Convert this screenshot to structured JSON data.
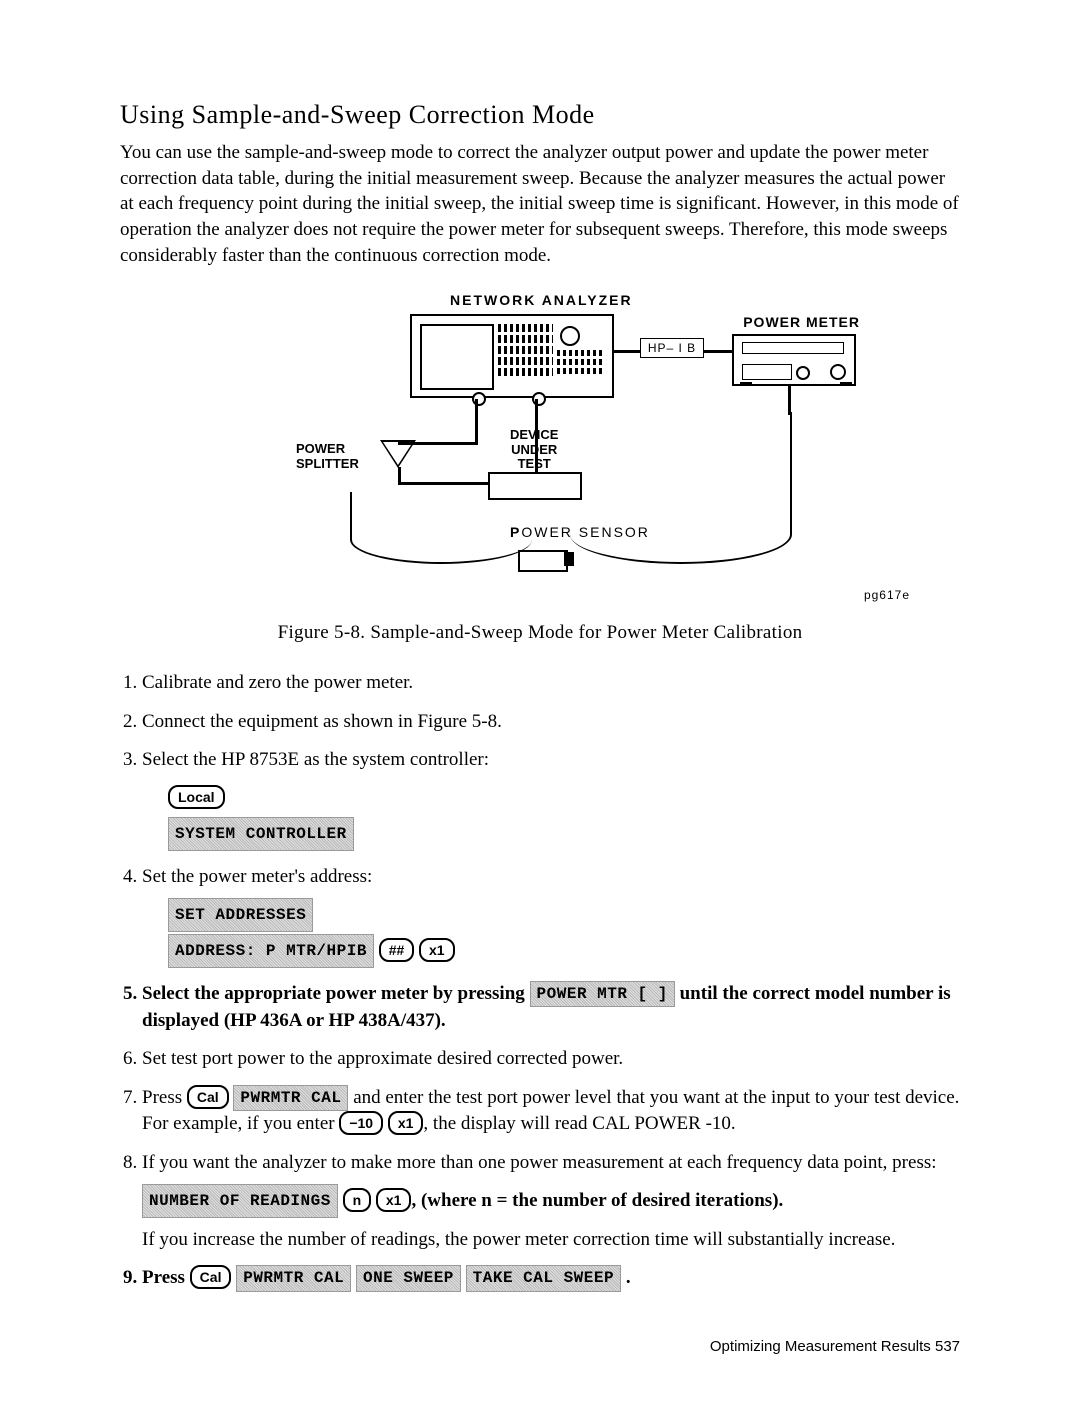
{
  "heading": "Using Sample-and-Sweep Correction Mode",
  "intro": "You can use the sample-and-sweep mode to correct the analyzer output power and update the power meter correction data table, during the initial measurement sweep. Because the analyzer measures the actual power at each frequency point during the initial sweep, the initial sweep time is significant. However, in this mode of operation the analyzer does not require the power meter for subsequent sweeps. Therefore, this mode sweeps considerably faster than the continuous  correction mode.",
  "diagram": {
    "network_analyzer": "NETWORK  ANALYZER",
    "hpib": "HP– I B",
    "power_meter": "POWER  METER",
    "power_splitter_line1": "POWER",
    "power_splitter_line2": "SPLITTER",
    "dut_line1": "DEVICE",
    "dut_line2": "UNDER",
    "dut_line3": "TEST",
    "power_sensor_label": "POWER SENSOR",
    "p_span": "P",
    "figref": "pg617e"
  },
  "figure_caption": "Figure 5-8. Sample-and-Sweep Mode for Power Meter Calibration",
  "steps": {
    "s1": "Calibrate and zero the power meter.",
    "s2": "Connect the equipment as shown in Figure 5-8.",
    "s3": "Select the HP 8753E as the system controller:",
    "s3_local": "Local",
    "s3_syscon": "SYSTEM CONTROLLER",
    "s4": "Set the power meter's address:",
    "s4_setaddr": "SET ADDRESSES",
    "s4_addr": "ADDRESS: P MTR/HPIB",
    "s4_hh": "##",
    "s4_x1": "x1",
    "s5_a": "Select the appropriate power meter by pressing ",
    "s5_key": "POWER MTR [  ]",
    "s5_b": " until the correct model number is displayed (HP 436A or HP 438A/437).",
    "s6": "Set test port power to the approximate desired corrected power.",
    "s7_a": "Press ",
    "s7_cal": "Cal",
    "s7_pwr": "PWRMTR CAL",
    "s7_b": " and enter the test port power level that you want at the input to your test device. For example, if you enter ",
    "s7_m10": "−10",
    "s7_x1": "x1",
    "s7_c": ", the display will read CAL POWER -10.",
    "s8_a": "If you want the analyzer to make more than one power measurement at each frequency data point, press:",
    "s8_key": "NUMBER OF READINGS",
    "s8_n": "n",
    "s8_x1": "x1",
    "s8_b": ", (where n = the number of desired iterations).",
    "s8_c": "If you increase the number of readings, the power meter correction time will substantially increase.",
    "s9_a": "Press ",
    "s9_cal": "Cal",
    "s9_k1": "PWRMTR CAL",
    "s9_k2": "ONE SWEEP",
    "s9_k3": "TAKE CAL SWEEP",
    "s9_period": " ."
  },
  "footer": "Optimizing Measurement Results 537"
}
